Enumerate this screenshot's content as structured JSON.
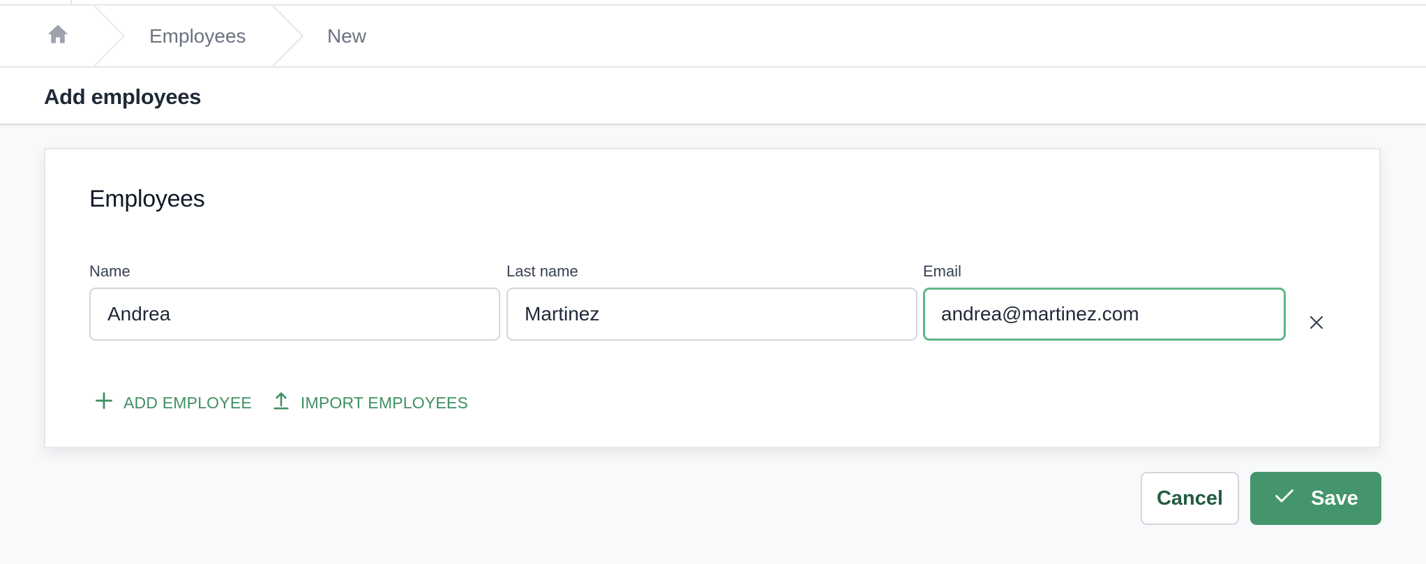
{
  "breadcrumb": {
    "home_icon": "home-icon",
    "items": [
      "Employees",
      "New"
    ]
  },
  "page": {
    "title": "Add employees"
  },
  "card": {
    "title": "Employees",
    "fields": {
      "name": {
        "label": "Name",
        "value": "Andrea"
      },
      "last_name": {
        "label": "Last name",
        "value": "Martinez"
      },
      "email": {
        "label": "Email",
        "value": "andrea@martinez.com",
        "focused": true
      }
    },
    "remove_icon": "close-icon",
    "actions": {
      "add_label": "Add employee",
      "import_label": "Import employees"
    }
  },
  "footer": {
    "cancel_label": "Cancel",
    "save_label": "Save"
  },
  "colors": {
    "accent": "#44956b",
    "link": "#3f8f62",
    "focus_border": "#5cb887",
    "cancel_text": "#235c3f",
    "background": "#f8f9fb"
  }
}
